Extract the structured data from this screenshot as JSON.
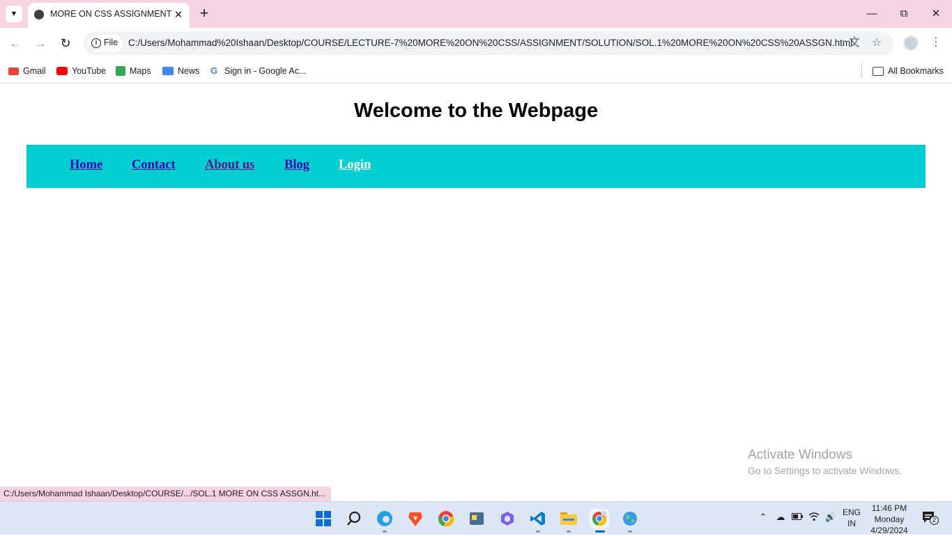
{
  "browser": {
    "tab_title": "MORE ON CSS ASSIGNMENT",
    "address_chip": "File",
    "url": "C:/Users/Mohammad%20Ishaan/Desktop/COURSE/LECTURE-7%20MORE%20ON%20CSS/ASSIGNMENT/SOLUTION/SOL.1%20MORE%20ON%20CSS%20ASSGN.html",
    "status_url": "C:/Users/Mohammad Ishaan/Desktop/COURSE/.../SOL.1 MORE ON CSS ASSGN.ht..."
  },
  "bookmarks": [
    {
      "label": "Gmail",
      "icon": "gmail-icon",
      "color": "#ea4335"
    },
    {
      "label": "YouTube",
      "icon": "youtube-icon",
      "color": "#ff0000"
    },
    {
      "label": "Maps",
      "icon": "maps-icon",
      "color": "#34a853"
    },
    {
      "label": "News",
      "icon": "news-icon",
      "color": "#4285f4"
    },
    {
      "label": "Sign in - Google Ac...",
      "icon": "google-icon",
      "color": "#4285f4"
    }
  ],
  "all_bookmarks_label": "All Bookmarks",
  "page": {
    "heading": "Welcome to the Webpage",
    "nav_bg": "#00ced1",
    "nav_links": [
      {
        "label": "Home",
        "state": "unvisited"
      },
      {
        "label": "Contact",
        "state": "unvisited"
      },
      {
        "label": "About us",
        "state": "visited"
      },
      {
        "label": "Blog",
        "state": "unvisited"
      },
      {
        "label": "Login",
        "state": "hover"
      }
    ]
  },
  "watermark": {
    "line1": "Activate Windows",
    "line2": "Go to Settings to activate Windows."
  },
  "taskbar": {
    "language": "ENG",
    "region": "IN",
    "time": "11:46 PM",
    "day": "Monday",
    "date": "4/29/2024",
    "notification_count": "2"
  }
}
